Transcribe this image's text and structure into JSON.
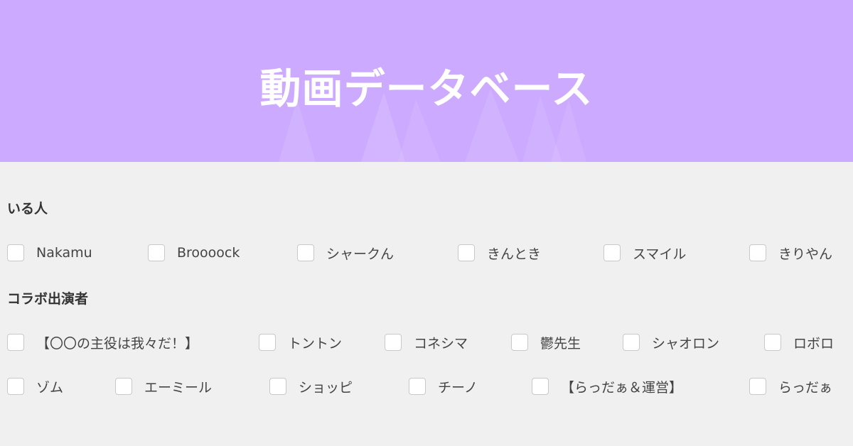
{
  "header": {
    "title": "動画データベース",
    "background": "#ccaaff"
  },
  "sections": [
    {
      "heading": "いる人",
      "options": [
        "Nakamu",
        "Broooock",
        "シャークん",
        "きんとき",
        "スマイル",
        "きりやん"
      ]
    },
    {
      "heading": "コラボ出演者",
      "options": [
        "【〇〇の主役は我々だ！】",
        "トントン",
        "コネシマ",
        "鬱先生",
        "シャオロン",
        "ロボロ",
        "ゾム",
        "エーミール",
        "ショッピ",
        "チーノ",
        "【らっだぁ＆運営】",
        "らっだぁ"
      ]
    }
  ]
}
